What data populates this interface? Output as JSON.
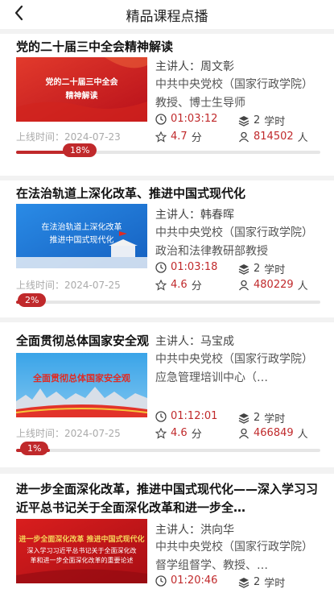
{
  "header": {
    "title": "精品课程点播",
    "back_icon": "back-arrow-icon"
  },
  "labels": {
    "lecturer_prefix": "主讲人：",
    "online_prefix": "上线时间：",
    "score_unit": "分",
    "people_unit": "人",
    "hours_unit": "学时"
  },
  "colors": {
    "accent": "#c0292b",
    "muted": "#aaaaaa"
  },
  "courses": [
    {
      "title": "党的二十届三中全会精神解读",
      "thumb_text_1": "党的二十届三中全会",
      "thumb_text_2": "精神解读",
      "lecturer": "周文彰",
      "org": "中共中央党校（国家行政学院）教授、博士生导师",
      "duration": "01:03:12",
      "hours": "2",
      "rating": "4.7",
      "learners": "814502",
      "online_date": "2024-07-23",
      "progress_label": "18%",
      "progress": 0.18
    },
    {
      "title": "在法治轨道上深化改革、推进中国式现代化",
      "thumb_text_1": "在法治轨道上深化改革",
      "thumb_text_2": "推进中国式现代化",
      "lecturer": "韩春晖",
      "org": "中共中央党校（国家行政学院）政治和法律教研部教授",
      "duration": "01:03:18",
      "hours": "2",
      "rating": "4.6",
      "learners": "480229",
      "online_date": "2024-07-25",
      "progress_label": "2%",
      "progress": 0.02
    },
    {
      "title": "全面贯彻总体国家安全观",
      "thumb_text_1": "全面贯彻总体国家安全观",
      "thumb_text_2": "",
      "lecturer": "马宝成",
      "org": "中共中央党校（国家行政学院）应急管理培训中心（…",
      "duration": "01:12:01",
      "hours": "2",
      "rating": "4.6",
      "learners": "466849",
      "online_date": "2024-07-25",
      "progress_label": "1%",
      "progress": 0.01
    },
    {
      "title": "进一步全面深化改革，推进中国式现代化——深入学习习近平总书记关于全面深化改革和进一步全…",
      "thumb_text_1": "进一步全面深化改革 推进中国式现代化",
      "thumb_text_2": "深入学习习近平总书记关于全面深化改革和进一步全面深化改革的重要论述",
      "lecturer": "洪向华",
      "org": "中共中央党校（国家行政学院）督学组督学、教授、…",
      "duration": "01:20:46",
      "hours": "2"
    }
  ]
}
